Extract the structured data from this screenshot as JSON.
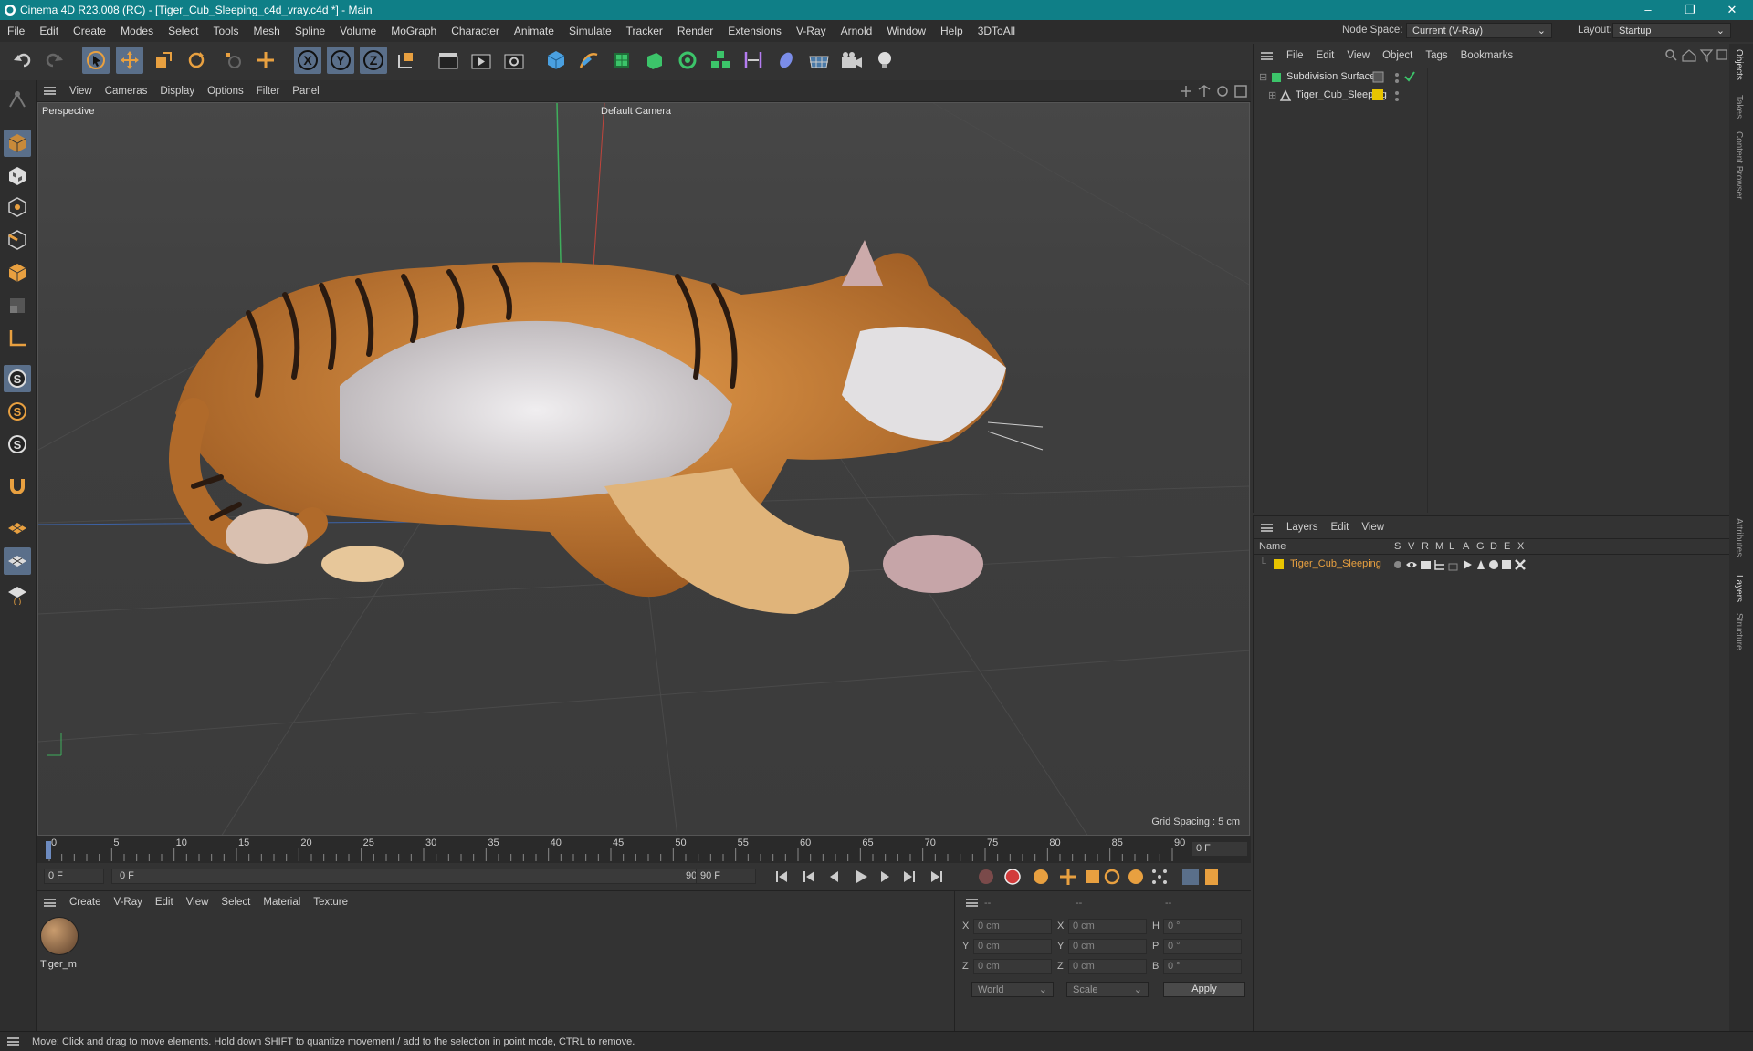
{
  "titlebar": {
    "title": "Cinema 4D R23.008 (RC) - [Tiger_Cub_Sleeping_c4d_vray.c4d *] - Main"
  },
  "menubar": {
    "items": [
      "File",
      "Edit",
      "Create",
      "Modes",
      "Select",
      "Tools",
      "Mesh",
      "Spline",
      "Volume",
      "MoGraph",
      "Character",
      "Animate",
      "Simulate",
      "Tracker",
      "Render",
      "Extensions",
      "V-Ray",
      "Arnold",
      "Window",
      "Help",
      "3DToAll"
    ],
    "node_space_label": "Node Space:",
    "node_space_value": "Current (V-Ray)",
    "layout_label": "Layout:",
    "layout_value": "Startup"
  },
  "toolbar": {
    "axis_x": "X",
    "axis_y": "Y",
    "axis_z": "Z"
  },
  "viewport": {
    "menu": [
      "View",
      "Cameras",
      "Display",
      "Options",
      "Filter",
      "Panel"
    ],
    "view_name": "Perspective",
    "camera": "Default Camera",
    "grid_spacing": "Grid Spacing : 5 cm"
  },
  "timeline": {
    "ticks": [
      "0",
      "5",
      "10",
      "15",
      "20",
      "25",
      "30",
      "35",
      "40",
      "45",
      "50",
      "55",
      "60",
      "65",
      "70",
      "75",
      "80",
      "85",
      "90"
    ],
    "current_frame": "0 F"
  },
  "transport": {
    "start_frame": "0 F",
    "range_start": "0 F",
    "range_end": "90 F",
    "end_frame": "90 F"
  },
  "material_manager": {
    "menu": [
      "Create",
      "V-Ray",
      "Edit",
      "View",
      "Select",
      "Material",
      "Texture"
    ],
    "materials": [
      {
        "name": "Tiger_m"
      }
    ]
  },
  "coordinates": {
    "header": [
      "--",
      "--",
      "--"
    ],
    "rows": [
      {
        "pos_label": "X",
        "pos": "0 cm",
        "size_label": "X",
        "size": "0 cm",
        "rot_label": "H",
        "rot": "0 °"
      },
      {
        "pos_label": "Y",
        "pos": "0 cm",
        "size_label": "Y",
        "size": "0 cm",
        "rot_label": "P",
        "rot": "0 °"
      },
      {
        "pos_label": "Z",
        "pos": "0 cm",
        "size_label": "Z",
        "size": "0 cm",
        "rot_label": "B",
        "rot": "0 °"
      }
    ],
    "mode": "World",
    "transform": "Scale",
    "apply": "Apply"
  },
  "object_manager": {
    "menu": [
      "File",
      "Edit",
      "View",
      "Object",
      "Tags",
      "Bookmarks"
    ],
    "objects": [
      {
        "name": "Subdivision Surface"
      },
      {
        "name": "Tiger_Cub_Sleeping"
      }
    ]
  },
  "layer_manager": {
    "menu": [
      "Layers",
      "Edit",
      "View"
    ],
    "columns": [
      "Name",
      "S",
      "V",
      "R",
      "M",
      "L",
      "A",
      "G",
      "D",
      "E",
      "X"
    ],
    "layers": [
      {
        "name": "Tiger_Cub_Sleeping",
        "color": "#e8c400"
      }
    ]
  },
  "right_tabs": [
    "Objects",
    "Takes",
    "Content Browser",
    "Attributes",
    "Layers",
    "Structure"
  ],
  "statusbar": {
    "text": "Move: Click and drag to move elements. Hold down SHIFT to quantize movement / add to the selection in point mode, CTRL to remove."
  },
  "colors": {
    "accent": "#0f7f87",
    "orange": "#e8a040",
    "selection": "#5a6f8a"
  }
}
